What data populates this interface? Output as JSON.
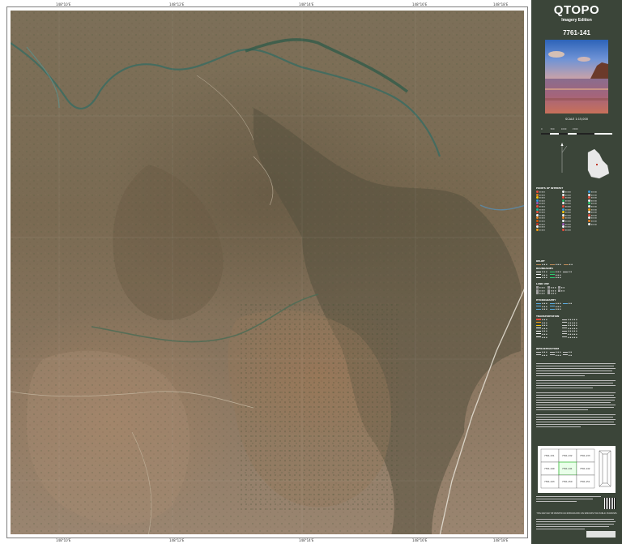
{
  "map": {
    "top_ticks": [
      "148°10'E",
      "148°12'E",
      "148°14'E",
      "148°16'E",
      "148°18'E"
    ],
    "bottom_ticks": [
      "148°10'E",
      "148°12'E",
      "148°14'E",
      "148°16'E",
      "148°18'E"
    ]
  },
  "panel": {
    "brand": "QTOPO",
    "edition": "Imagery Edition",
    "sheet_number": "7761-141",
    "scale_text": "SCALE 1:15,000",
    "scale_ticks": [
      "0",
      "500",
      "1000",
      "1500"
    ],
    "legend_headings": [
      "POINTS OF INTEREST",
      "RELIEF",
      "BOUNDARIES",
      "LAND USE",
      "HYDROGRAPHY",
      "TRANSPORTATION",
      "INFRASTRUCTURE"
    ],
    "index_sheets": [
      "7761-131",
      "7761-132",
      "7761-133",
      "7761-140",
      "7761-141",
      "7761-142",
      "7761-143",
      "7761-150",
      "7761-151"
    ],
    "note": "THIS MAP MAY BE PRINTED OR REPRODUCED ON SERVICES FOR PUBLIC PURPOSES",
    "colors": {
      "panel_bg": "#3b4539",
      "brand_text": "#ffffff",
      "index_highlight": "#3cc13c"
    }
  }
}
